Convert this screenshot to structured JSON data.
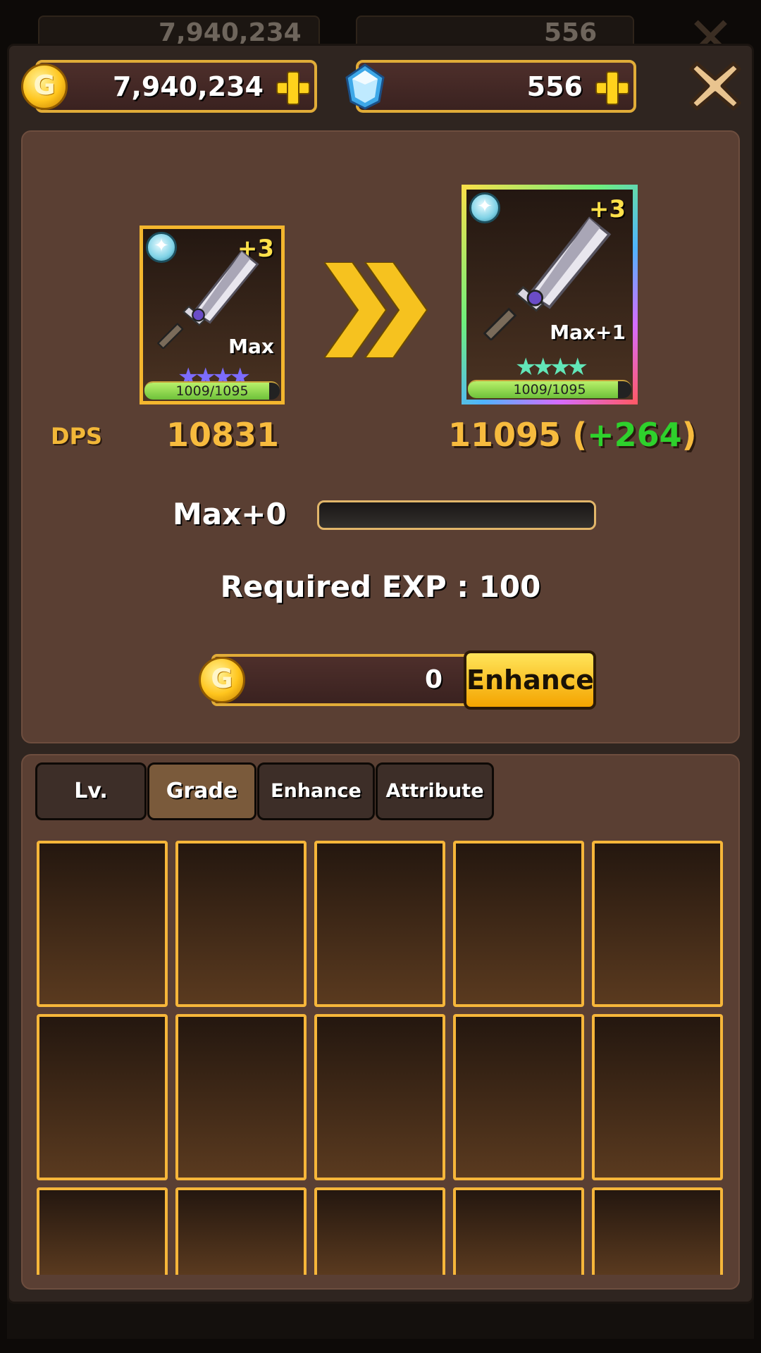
{
  "currency": {
    "gold": "7,940,234",
    "gems": "556"
  },
  "cards": {
    "current": {
      "plus": "+3",
      "grade": "Max",
      "stars": "★★★★",
      "exp": "1009/1095",
      "exp_fraction": 0.92
    },
    "next": {
      "plus": "+3",
      "grade": "Max+1",
      "stars": "★★★★",
      "exp": "1009/1095",
      "exp_fraction": 0.92
    }
  },
  "stats": {
    "dps_label": "DPS",
    "dps_current": "10831",
    "dps_next": "11095",
    "dps_gain_open": "(",
    "dps_gain": "+264",
    "dps_gain_close": ")"
  },
  "enhance": {
    "level_label": "Max+0",
    "progress_fraction": 0,
    "required_exp": "Required EXP : 100",
    "cost": "0",
    "button": "Enhance"
  },
  "tabs": [
    {
      "label": "Lv."
    },
    {
      "label": "Grade"
    },
    {
      "label": "Enhance"
    },
    {
      "label": "Attribute"
    }
  ],
  "colors": {
    "gold_border": "#e1ac38",
    "gain_green": "#2ed12c",
    "dps_orange": "#f7bb3e"
  },
  "icons": [
    "gold-coin-icon",
    "gem-icon",
    "plus-icon",
    "close-icon",
    "sword-icon",
    "chevron-arrow-icon",
    "star-icon",
    "element-badge-icon"
  ]
}
